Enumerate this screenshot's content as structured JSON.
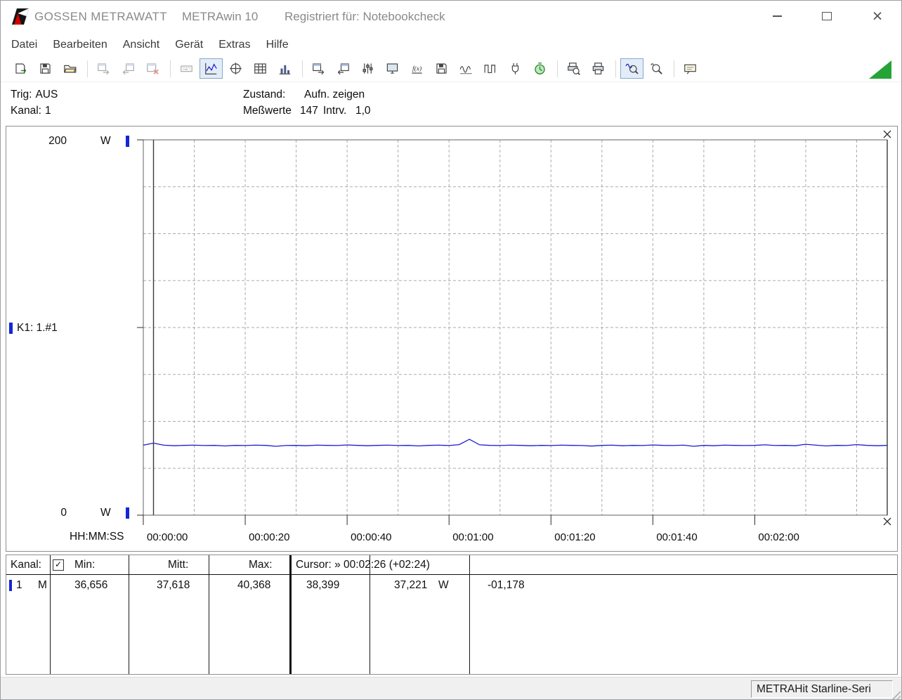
{
  "window": {
    "brand": "GOSSEN METRAWATT",
    "app_title": "METRAwin 10",
    "registered": "Registriert für: Notebookcheck"
  },
  "menu": {
    "items": [
      "Datei",
      "Bearbeiten",
      "Ansicht",
      "Gerät",
      "Extras",
      "Hilfe"
    ]
  },
  "toolbar": {
    "items": [
      {
        "type": "button",
        "name": "file-import-button",
        "icon": "floppyArrow"
      },
      {
        "type": "button",
        "name": "file-save-button",
        "icon": "floppy"
      },
      {
        "type": "button",
        "name": "file-open-button",
        "icon": "folder"
      },
      {
        "type": "sep"
      },
      {
        "type": "button",
        "name": "window-export-button",
        "icon": "winArrowR",
        "disabled": true
      },
      {
        "type": "button",
        "name": "window-transfer-button",
        "icon": "winArrowL",
        "disabled": true
      },
      {
        "type": "button",
        "name": "window-close-button",
        "icon": "winX",
        "disabled": true
      },
      {
        "type": "sep"
      },
      {
        "type": "button",
        "name": "display-view-button",
        "icon": "keyboard",
        "disabled": true
      },
      {
        "type": "button",
        "name": "line-chart-view-button",
        "icon": "chartLine",
        "pressed": true
      },
      {
        "type": "button",
        "name": "scope-view-button",
        "icon": "crosshair"
      },
      {
        "type": "button",
        "name": "table-view-button",
        "icon": "tableIcon"
      },
      {
        "type": "button",
        "name": "bargraph-view-button",
        "icon": "bars"
      },
      {
        "type": "sep"
      },
      {
        "type": "button",
        "name": "device-send-button",
        "icon": "winArrowR"
      },
      {
        "type": "button",
        "name": "device-receive-button",
        "icon": "winArrowL"
      },
      {
        "type": "button",
        "name": "device-config-button",
        "icon": "sliders"
      },
      {
        "type": "button",
        "name": "device-monitor-button",
        "icon": "monitor"
      },
      {
        "type": "button",
        "name": "formula-button",
        "icon": "fx"
      },
      {
        "type": "button",
        "name": "memory-read-button",
        "icon": "floppy"
      },
      {
        "type": "button",
        "name": "signal-small-button",
        "icon": "waveS"
      },
      {
        "type": "button",
        "name": "signal-large-button",
        "icon": "waveL"
      },
      {
        "type": "button",
        "name": "power-log-button",
        "icon": "plug"
      },
      {
        "type": "button",
        "name": "record-timer-button",
        "icon": "timer"
      },
      {
        "type": "sep"
      },
      {
        "type": "button",
        "name": "print-preview-button",
        "icon": "printPrev"
      },
      {
        "type": "button",
        "name": "print-button",
        "icon": "printer"
      },
      {
        "type": "sep"
      },
      {
        "type": "button",
        "name": "zoom-curve-button",
        "icon": "zoomWave",
        "pressed": true
      },
      {
        "type": "button",
        "name": "zoom-out-button",
        "icon": "zoomOut"
      },
      {
        "type": "sep"
      },
      {
        "type": "button",
        "name": "annotation-button",
        "icon": "note"
      }
    ]
  },
  "status": {
    "trig_label": "Trig:",
    "trig_value": "AUS",
    "kanal_label": "Kanal:",
    "kanal_value": "1",
    "zustand_label": "Zustand:",
    "zustand_value": "Aufn. zeigen",
    "messwerte_label": "Meßwerte",
    "messwerte_value": "147",
    "intrv_label": "Intrv.",
    "intrv_value": "1,0"
  },
  "chart": {
    "y_max": "200",
    "y_min": "0",
    "y_unit": "W",
    "channel_label": "K1: 1.#1",
    "x_axis_label": "HH:MM:SS"
  },
  "chart_data": {
    "type": "line",
    "title": "",
    "ylabel": "W",
    "ylim": [
      0,
      200
    ],
    "y_divisions": 8,
    "xlabel": "HH:MM:SS",
    "x_range_seconds": [
      0,
      146
    ],
    "x_grid_seconds": 10,
    "x_tick_seconds": [
      0,
      20,
      40,
      60,
      80,
      100,
      120
    ],
    "x_ticks": [
      "00:00:00",
      "00:00:20",
      "00:00:40",
      "00:01:00",
      "00:01:20",
      "00:01:40",
      "00:02:00"
    ],
    "grid": true,
    "legend": "none",
    "line_color": "#1b1bd0",
    "series": [
      {
        "name": "K1: 1.#1",
        "unit": "W",
        "color": "#1b1bd0",
        "x_step_seconds": 2,
        "values": [
          37.3,
          38.4,
          37.3,
          37.0,
          37.2,
          37.3,
          37.1,
          37.2,
          36.9,
          37.2,
          37.1,
          37.3,
          37.2,
          36.7,
          37.1,
          37.2,
          37.0,
          37.3,
          37.2,
          37.1,
          37.4,
          37.2,
          37.0,
          37.2,
          37.3,
          37.1,
          37.2,
          36.9,
          37.2,
          37.3,
          37.1,
          37.6,
          40.4,
          37.5,
          37.2,
          37.1,
          37.3,
          37.2,
          37.0,
          37.2,
          37.1,
          37.3,
          37.2,
          37.1,
          36.8,
          37.2,
          37.3,
          37.0,
          37.2,
          37.1,
          37.4,
          37.2,
          37.1,
          37.3,
          36.7,
          37.2,
          37.0,
          37.3,
          37.2,
          37.1,
          37.2,
          37.5,
          37.1,
          37.2,
          37.0,
          37.8,
          37.3,
          36.9,
          37.2,
          37.1,
          37.6,
          37.2,
          37.0,
          37.2
        ]
      }
    ],
    "cursors": {
      "cursor1_seconds": 2,
      "cursor2_seconds": 146
    },
    "stats": {
      "min": 36.656,
      "mean": 37.618,
      "max": 40.368,
      "cursor1_value": 38.399,
      "cursor2_value": 37.221,
      "delta": -1.178
    }
  },
  "table": {
    "header": {
      "kanal": "Kanal:",
      "checkbox_checked": true,
      "min": "Min:",
      "mitt": "Mitt:",
      "max": "Max:",
      "cursor": "Cursor: » 00:02:26 (+02:24)"
    },
    "row": {
      "channel": "1",
      "mode": "M",
      "min": "36,656",
      "mitt": "37,618",
      "max": "40,368",
      "cursor_a": "38,399",
      "cursor_b": "37,221",
      "unit": "W",
      "delta": "-01,178"
    }
  },
  "statusbar": {
    "device": "METRAHit Starline-Seri"
  }
}
